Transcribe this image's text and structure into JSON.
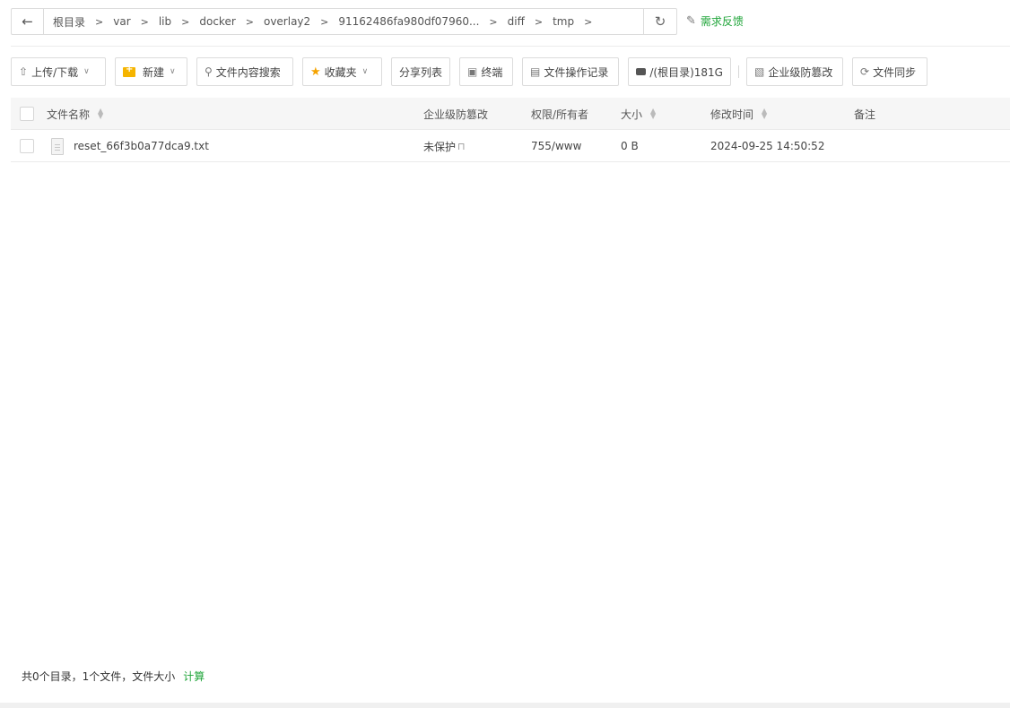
{
  "path": {
    "crumbs": [
      "根目录",
      "var",
      "lib",
      "docker",
      "overlay2",
      "91162486fa980df07960...",
      "diff",
      "tmp"
    ]
  },
  "feedback_label": "需求反馈",
  "toolbar": {
    "upload_download": "上传/下载",
    "new": "新建",
    "search_content": "文件内容搜索",
    "favorites": "收藏夹",
    "share_list": "分享列表",
    "terminal": "终端",
    "file_ops_log": "文件操作记录",
    "disk": "/(根目录)181G",
    "tamper_proof": "企业级防篡改",
    "file_sync": "文件同步"
  },
  "table": {
    "columns": {
      "name": "文件名称",
      "tamper": "企业级防篡改",
      "perm": "权限/所有者",
      "size": "大小",
      "mtime": "修改时间",
      "note": "备注"
    },
    "rows": [
      {
        "name": "reset_66f3b0a77dca9.txt",
        "tamper": "未保护",
        "perm": "755/www",
        "size": "0 B",
        "mtime": "2024-09-25 14:50:52",
        "note": ""
      }
    ]
  },
  "footer": {
    "summary": "共0个目录，1个文件，文件大小",
    "calc": "计算"
  },
  "colors": {
    "accent": "#20a53a",
    "star": "#f5a300",
    "folder": "#f5b400"
  }
}
